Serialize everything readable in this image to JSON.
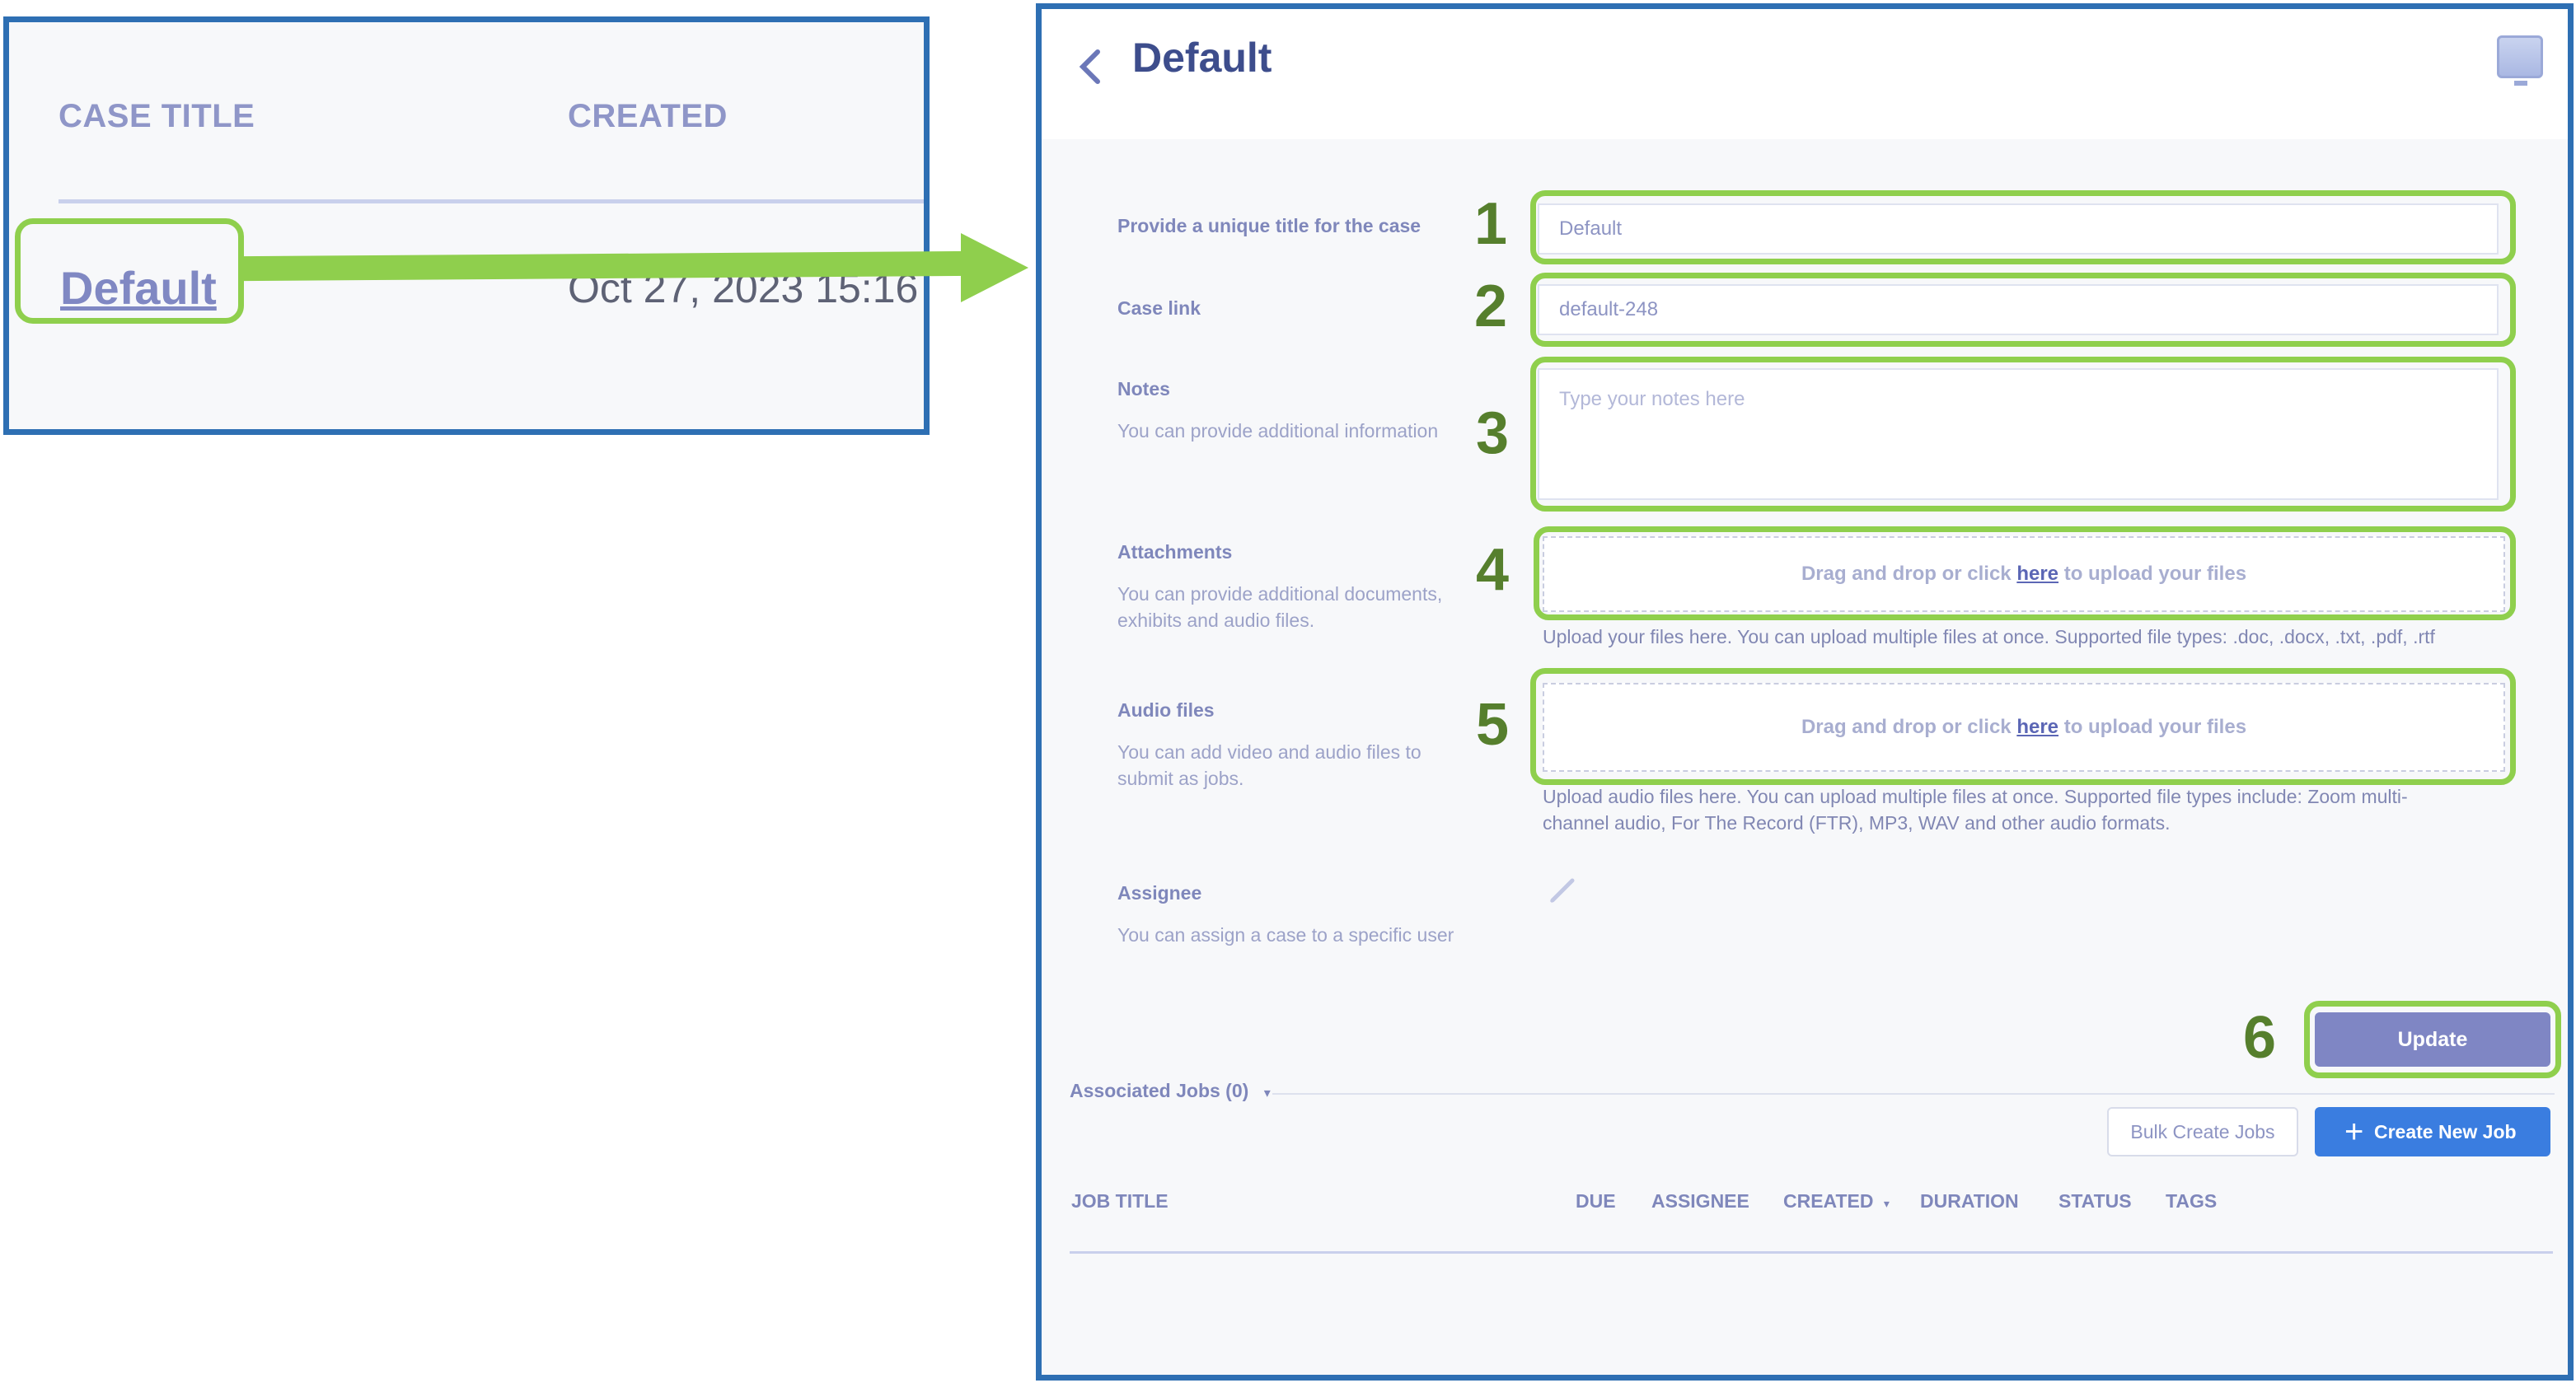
{
  "case_list": {
    "columns": [
      "CASE TITLE",
      "CREATED"
    ],
    "rows": [
      {
        "title": "Default",
        "created": "Oct 27, 2023 15:16"
      }
    ]
  },
  "case_detail": {
    "title": "Default",
    "fields": {
      "title": {
        "label": "Provide a unique title for the case",
        "value": "Default",
        "marker": "1"
      },
      "link": {
        "label": "Case link",
        "value": "default-248",
        "marker": "2"
      },
      "notes": {
        "label": "Notes",
        "help": "You can provide additional information",
        "placeholder": "Type your notes here",
        "marker": "3"
      },
      "attachments": {
        "label": "Attachments",
        "help": "You can provide additional documents, exhibits and audio files.",
        "drop_prefix": "Drag and drop or click ",
        "drop_link": "here",
        "drop_suffix": " to upload your files",
        "hint": "Upload your files here. You can upload multiple files at once. Supported file types: .doc, .docx, .txt, .pdf, .rtf",
        "marker": "4"
      },
      "audio": {
        "label": "Audio files",
        "help": "You can add video and audio files to submit as jobs.",
        "drop_prefix": "Drag and drop or click ",
        "drop_link": "here",
        "drop_suffix": " to upload your files",
        "hint": "Upload audio files here. You can upload multiple files at once. Supported file types include: Zoom multi-channel audio, For The Record (FTR), MP3, WAV and other audio formats.",
        "marker": "5"
      },
      "assignee": {
        "label": "Assignee",
        "help": "You can assign a case to a specific user"
      }
    },
    "update": {
      "label": "Update",
      "marker": "6"
    },
    "associated_jobs": {
      "label": "Associated Jobs (0)",
      "caret": "▾",
      "bulk_label": "Bulk Create Jobs",
      "create_label": "Create New Job",
      "columns": [
        "JOB TITLE",
        "DUE",
        "ASSIGNEE",
        "CREATED",
        "DURATION",
        "STATUS",
        "TAGS"
      ],
      "sort_caret": "▾"
    }
  },
  "colors": {
    "highlight": "#8fcf4d",
    "frame": "#2e6fb3",
    "primary": "#3a7de0",
    "update": "#7f86c4"
  },
  "icons": [
    "back-chevron-icon",
    "screen-icon",
    "pencil-icon",
    "plus-icon",
    "caret-down-icon"
  ]
}
